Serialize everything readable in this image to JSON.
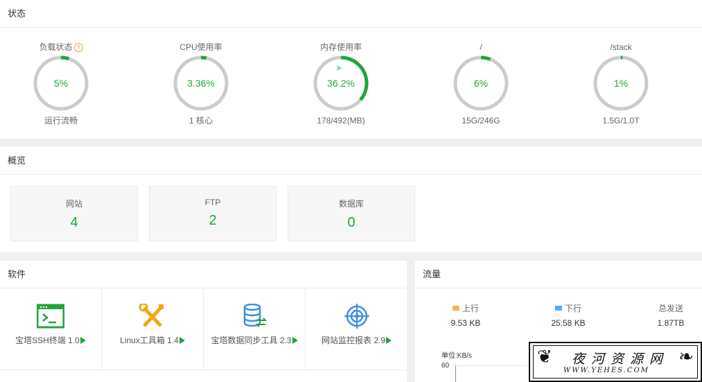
{
  "status": {
    "title": "状态",
    "gauges": [
      {
        "title": "负载状态",
        "help": "?",
        "value_text": "5%",
        "percent": 5,
        "sub": "运行流畅"
      },
      {
        "title": "CPU使用率",
        "value_text": "3.36%",
        "percent": 3.36,
        "sub": "1 核心"
      },
      {
        "title": "内存使用率",
        "value_text": "36.2%",
        "percent": 36.2,
        "sub": "178/492(MB)",
        "icon": "rocket-icon"
      },
      {
        "title": "/",
        "value_text": "6%",
        "percent": 6,
        "sub": "15G/246G"
      },
      {
        "title": "/stack",
        "value_text": "1%",
        "percent": 1,
        "sub": "1.5G/1.0T"
      }
    ]
  },
  "overview": {
    "title": "概览",
    "cards": [
      {
        "label": "网站",
        "value": "4"
      },
      {
        "label": "FTP",
        "value": "2"
      },
      {
        "label": "数据库",
        "value": "0"
      }
    ]
  },
  "software": {
    "title": "软件",
    "items": [
      {
        "name": "宝塔SSH终端 1.0",
        "icon": "terminal-icon"
      },
      {
        "name": "Linux工具箱 1.4",
        "icon": "tools-icon"
      },
      {
        "name": "宝塔数据同步工具 2.3",
        "icon": "database-sync-icon"
      },
      {
        "name": "网站监控报表 2.9",
        "icon": "monitor-target-icon"
      }
    ]
  },
  "traffic": {
    "title": "流量",
    "up_label": "上行",
    "up_value": "9.53 KB",
    "down_label": "下行",
    "down_value": "25.58 KB",
    "total_label": "总发送",
    "total_value": "1.87TB",
    "unit": "单位:KB/s",
    "y_tick": "60"
  },
  "watermark": {
    "title": "夜河资源网",
    "url": "WWW.YEHES.COM"
  },
  "colors": {
    "accent": "#20a53a",
    "ring_track": "#cccccc",
    "upload": "#f7b851",
    "download": "#52a9ff"
  }
}
